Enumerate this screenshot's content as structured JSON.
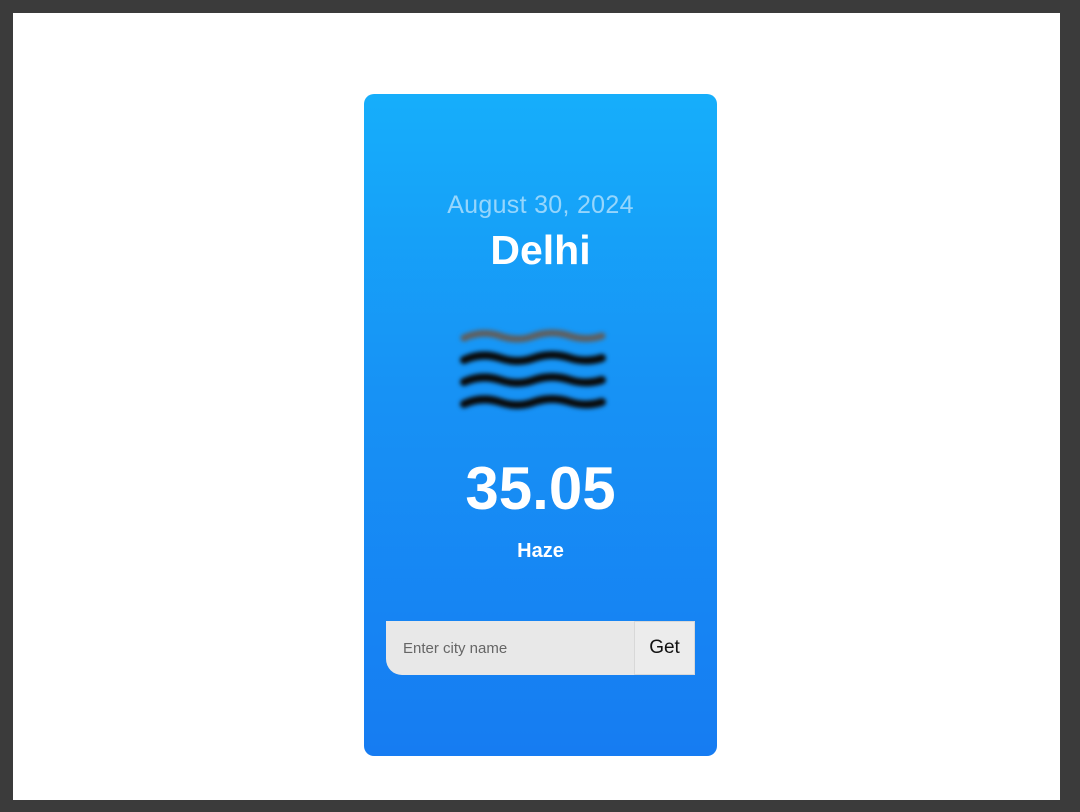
{
  "weather": {
    "date": "August 30, 2024",
    "city": "Delhi",
    "icon": "haze-icon",
    "temperature": "35.05",
    "condition": "Haze"
  },
  "search": {
    "placeholder": "Enter city name",
    "value": "",
    "button_label": "Get"
  },
  "colors": {
    "frame": "#3b3b3b",
    "page_background": "#ffffff",
    "card_gradient_top": "#16aefb",
    "card_gradient_bottom": "#167cf2",
    "input_background": "#e8e8e8",
    "text": "#ffffff"
  }
}
